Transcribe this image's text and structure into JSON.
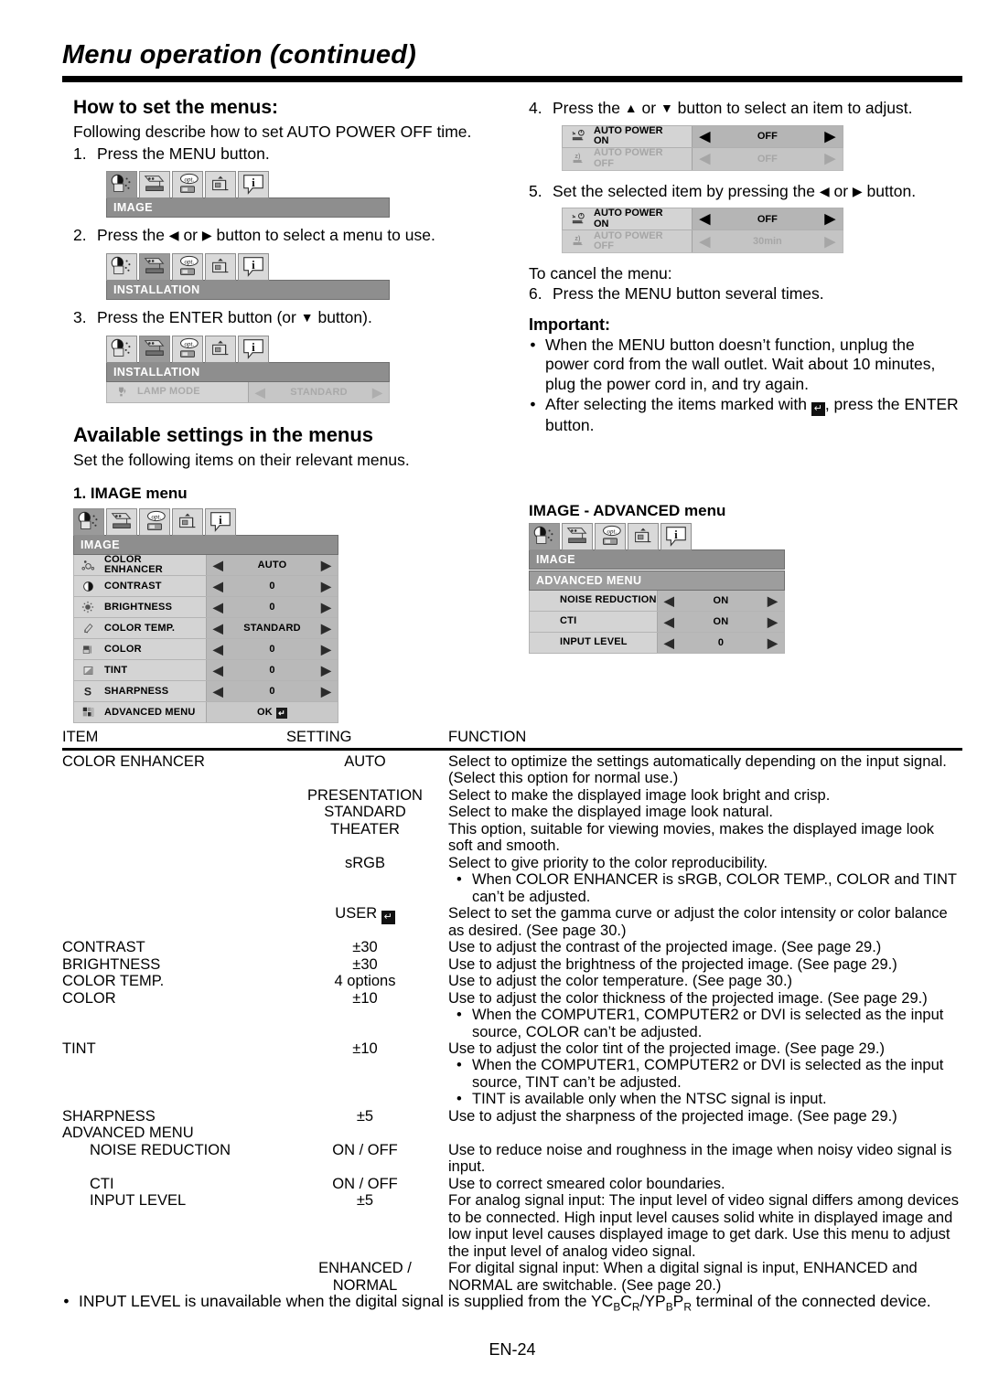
{
  "header": {
    "title": "Menu operation (continued)"
  },
  "left": {
    "heading": "How to set the menus:",
    "intro": "Following describe how to set AUTO POWER OFF time.",
    "step1": {
      "num": "1.",
      "text": "Press the MENU button."
    },
    "step2": {
      "num": "2.",
      "text_a": "Press the ",
      "tri_left": "◀",
      "text_b": " or ",
      "tri_right": "▶",
      "text_c": " button to select a menu to use."
    },
    "step3": {
      "num": "3.",
      "text_a": "Press the ENTER button (or ",
      "tri_down": "▼",
      "text_b": " button)."
    },
    "osd1": {
      "bar": "IMAGE",
      "selected_tab": 0
    },
    "osd2": {
      "bar": "INSTALLATION",
      "selected_tab": 1
    },
    "osd3": {
      "bar": "INSTALLATION",
      "selected_tab": 1,
      "row_label": "LAMP MODE",
      "row_value": "STANDARD"
    },
    "section2_heading": "Available settings in the menus",
    "section2_intro": "Set the following items on their relevant menus.",
    "menu1_title": "1. IMAGE menu",
    "image_menu": {
      "bar": "IMAGE",
      "rows": [
        {
          "icon": "color-enhancer-icon",
          "label": "COLOR\nENHANCER",
          "value": "AUTO",
          "arrows": true
        },
        {
          "icon": "contrast-icon",
          "label": "CONTRAST",
          "value": "0",
          "arrows": true
        },
        {
          "icon": "brightness-icon",
          "label": "BRIGHTNESS",
          "value": "0",
          "arrows": true
        },
        {
          "icon": "color-temp-icon",
          "label": "COLOR TEMP.",
          "value": "STANDARD",
          "arrows": true
        },
        {
          "icon": "color-icon",
          "label": "COLOR",
          "value": "0",
          "arrows": true
        },
        {
          "icon": "tint-icon",
          "label": "TINT",
          "value": "0",
          "arrows": true
        },
        {
          "icon": "sharpness-icon",
          "label": "SHARPNESS",
          "value": "0",
          "arrows": true
        },
        {
          "icon": "advanced-menu-icon",
          "label": "ADVANCED MENU",
          "value": "OK",
          "arrows": false,
          "enter_mark": true
        }
      ]
    }
  },
  "right": {
    "step4": {
      "num": "4.",
      "text_a": "Press the ",
      "tri_up": "▲",
      "text_b": " or ",
      "tri_down": "▼",
      "text_c": " button to select an item to adjust."
    },
    "step5": {
      "num": "5.",
      "text_a": "Set the selected item by pressing the ",
      "tri_left": "◀",
      "text_b": " or ",
      "tri_right": "▶",
      "text_c": " button."
    },
    "osd4": {
      "rows": [
        {
          "icon": "auto-power-on-icon",
          "label": "AUTO POWER\nON",
          "value": "OFF",
          "dim": false
        },
        {
          "icon": "auto-power-off-icon",
          "label": "AUTO POWER\nOFF",
          "value": "OFF",
          "dim": true
        }
      ]
    },
    "osd5": {
      "rows": [
        {
          "icon": "auto-power-on-icon",
          "label": "AUTO POWER\nON",
          "value": "OFF",
          "dim": false
        },
        {
          "icon": "auto-power-off-icon",
          "label": "AUTO POWER\nOFF",
          "value": "30min",
          "dim": true
        }
      ]
    },
    "cancel_line": "To cancel the menu:",
    "step6": {
      "num": "6.",
      "text": "Press the MENU button several times."
    },
    "important_heading": "Important:",
    "important_1": "When the MENU button doesn’t function, unplug the power cord from the wall outlet. Wait about 10 minutes, plug the power cord in, and try again.",
    "important_2a": "After selecting the items marked with ",
    "important_2b": ", press the ENTER button.",
    "menu2_title": "IMAGE - ADVANCED menu",
    "advanced_menu": {
      "bar1": "IMAGE",
      "bar2": "ADVANCED MENU",
      "rows": [
        {
          "label": "NOISE REDUCTION",
          "value": "ON"
        },
        {
          "label": "CTI",
          "value": "ON"
        },
        {
          "label": "INPUT LEVEL",
          "value": "0"
        }
      ]
    }
  },
  "table": {
    "headers": {
      "item": "ITEM",
      "setting": "SETTING",
      "function": "FUNCTION"
    },
    "rows": [
      {
        "item": "COLOR ENHANCER",
        "setting": "AUTO",
        "function": "Select to optimize the settings automatically depending on the input signal. (Select this option for normal use.)"
      },
      {
        "item": "",
        "setting": "PRESENTATION",
        "function": "Select to make the displayed image look bright and crisp."
      },
      {
        "item": "",
        "setting": "STANDARD",
        "function": "Select to make the displayed image look natural."
      },
      {
        "item": "",
        "setting": "THEATER",
        "function": "This option, suitable for viewing movies, makes the displayed image look soft and smooth."
      },
      {
        "item": "",
        "setting": "sRGB",
        "function": "Select to give priority to the color reproducibility.",
        "bullets": [
          "When COLOR ENHANCER is sRGB, COLOR TEMP., COLOR and TINT can’t be adjusted."
        ]
      },
      {
        "item": "",
        "setting": "USER",
        "setting_enter": true,
        "function": "Select to set the gamma curve or adjust the color intensity or color balance as desired. (See page 30.)"
      },
      {
        "item": "CONTRAST",
        "setting": "±30",
        "function": "Use to adjust the contrast of the projected image. (See page 29.)"
      },
      {
        "item": "BRIGHTNESS",
        "setting": "±30",
        "function": "Use to adjust the brightness of the projected image. (See page 29.)"
      },
      {
        "item": "COLOR TEMP.",
        "setting": "4 options",
        "function": "Use to adjust the color temperature. (See page 30.)"
      },
      {
        "item": "COLOR",
        "setting": "±10",
        "function": "Use to adjust the color thickness of the projected image. (See page 29.)",
        "bullets": [
          "When the COMPUTER1, COMPUTER2 or DVI is selected as the input source, COLOR can’t be adjusted."
        ]
      },
      {
        "item": "TINT",
        "setting": "±10",
        "function": "Use to adjust the color tint of the projected image. (See page 29.)",
        "bullets": [
          "When the COMPUTER1, COMPUTER2 or DVI is selected as the input source, TINT can’t be adjusted.",
          "TINT is available only when the NTSC signal is input."
        ]
      },
      {
        "item": "SHARPNESS",
        "setting": "±5",
        "function": "Use to adjust the sharpness of the projected image. (See page 29.)"
      },
      {
        "item": "ADVANCED MENU",
        "setting": "",
        "function": ""
      },
      {
        "item": "NOISE REDUCTION",
        "indent": true,
        "setting": "ON / OFF",
        "function": "Use to reduce noise and roughness in the image when noisy video signal is input."
      },
      {
        "item": "CTI",
        "indent": true,
        "setting": "ON / OFF",
        "function": "Use to correct smeared color boundaries."
      },
      {
        "item": "INPUT LEVEL",
        "indent": true,
        "setting": "±5",
        "function": "For analog signal input: The input level of video signal differs among devices to be connected. High input level causes solid white in displayed image and low input level causes displayed image to get dark. Use this menu to adjust the input level of analog video signal."
      },
      {
        "item": "",
        "setting": "ENHANCED /\nNORMAL",
        "function": "For digital signal input: When a digital signal is input, ENHANCED and NORMAL are switchable. (See page 20.)"
      }
    ]
  },
  "footer": {
    "note_a": "INPUT LEVEL is unavailable when the digital signal is supplied from the YC",
    "note_sub1": "B",
    "note_b": "C",
    "note_sub2": "R",
    "note_c": "/YP",
    "note_sub3": "B",
    "note_d": "P",
    "note_sub4": "R",
    "note_e": " terminal of the connected device.",
    "page_number": "EN-24"
  }
}
